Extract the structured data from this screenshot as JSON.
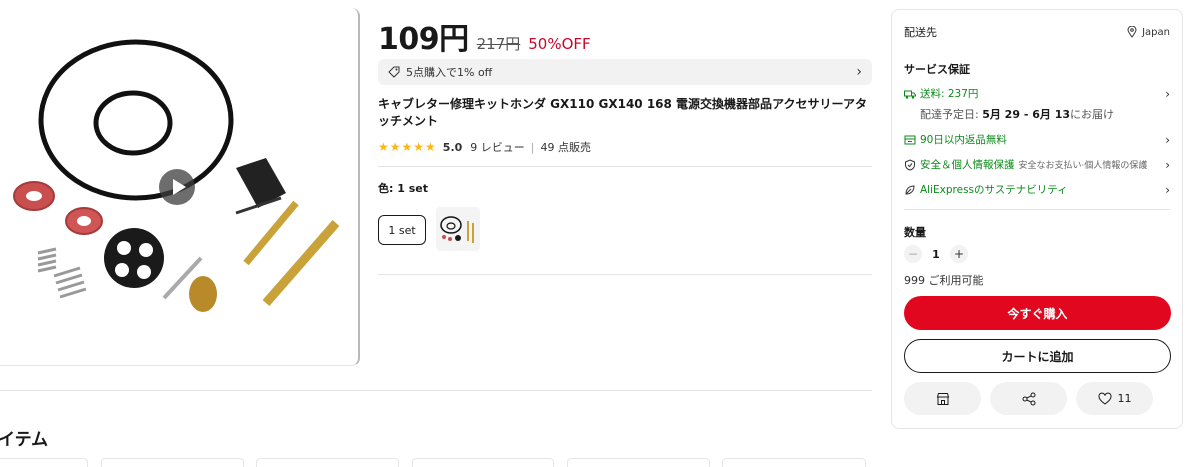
{
  "product": {
    "price": "109円",
    "original_price": "217円",
    "discount": "50%OFF",
    "promo": "5点購入で1% off",
    "title": "キャブレター修理キットホンダ GX110 GX140 168 電源交換機器部品アクセサリーアタッチメント",
    "rating_score": "5.0",
    "reviews": "9 レビュー",
    "sold": "49 点販売",
    "color_label": "色: 1 set",
    "variant_label": "1 set"
  },
  "panel": {
    "ship_to_label": "配送先",
    "ship_to_location": "Japan",
    "service_heading": "サービス保証",
    "shipping_fee": "送料: 237円",
    "delivery_prefix": "配達予定日: ",
    "delivery_dates": "5月 29 - 6月 13",
    "delivery_suffix": "にお届け",
    "returns": "90日以内返品無料",
    "security": "安全＆個人情報保護",
    "security_sub": "安全なお支払い·個人情報の保護",
    "sustainability": "AliExpressのサステナビリティ",
    "qty_label": "数量",
    "qty_value": "1",
    "minus": "−",
    "plus": "+",
    "available": "999 ご利用可能",
    "buy_now": "今すぐ購入",
    "add_to_cart": "カートに追加",
    "wishlist_count": "11"
  },
  "section": {
    "title": "イテム"
  },
  "colors": {
    "accent_red": "#e0071f",
    "discount_red": "#c7082b",
    "service_green": "#0c8a1c",
    "star_yellow": "#fdb714"
  }
}
